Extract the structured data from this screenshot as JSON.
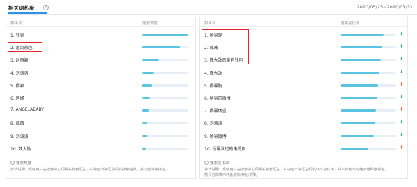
{
  "header": {
    "title": "相关词热度",
    "help_glyph": "?",
    "date_range": "2020/05/25~2020/05/31"
  },
  "left_panel": {
    "col_keyword": "相关词",
    "col_metric": "搜索热度",
    "rows": [
      {
        "label": "1.  钱睿",
        "level": 1.0
      },
      {
        "label": "2.  追风热芭",
        "level": 0.82
      },
      {
        "label": "3.  赵丽颖",
        "level": 0.36
      },
      {
        "label": "4.  刘诗诗",
        "level": 0.24
      },
      {
        "label": "5.  杨颖",
        "level": 0.2
      },
      {
        "label": "6.  唐嫣",
        "level": 0.16
      },
      {
        "label": "7.  ANGELABABY",
        "level": 0.13
      },
      {
        "label": "8.  戚薇",
        "level": 0.11
      },
      {
        "label": "9.  刘涛涛",
        "level": 0.1
      },
      {
        "label": "10. 魏大勋",
        "level": 0.08
      }
    ],
    "footer_title": "搜索热度",
    "footer_desc": "算法说明：反映用户在搜索中心词相关搜索汇总，并综合计算汇总词的搜索指数，并以此降序排名。"
  },
  "right_panel": {
    "col_keyword": "相关词",
    "col_metric": "搜索变化率",
    "rows": [
      {
        "label": "1.  杨幂穿",
        "level": 0.78,
        "trend": "down"
      },
      {
        "label": "2.  戚薇",
        "level": 0.75,
        "trend": "down"
      },
      {
        "label": "3.  魏大勋恋爱有钱吗",
        "level": 0.72,
        "trend": "down"
      },
      {
        "label": "4.  魏大勋",
        "level": 0.7,
        "trend": "down"
      },
      {
        "label": "5.  杨幂胸",
        "level": 0.68,
        "trend": "up"
      },
      {
        "label": "6.  杨幂的微博",
        "level": 0.66,
        "trend": "down"
      },
      {
        "label": "7.  杨幂体重",
        "level": 0.64,
        "trend": "up"
      },
      {
        "label": "8.  刘涛涛",
        "level": 0.62,
        "trend": "down"
      },
      {
        "label": "9.  杨幂微博",
        "level": 0.6,
        "trend": "down"
      },
      {
        "label": "10. 杨幂演过的电视剧",
        "level": 0.5,
        "trend": "up"
      }
    ],
    "footer_title": "搜索变化率",
    "footer_desc_line1": "算法说明：反映用户在搜索中心词相关搜索汇总，并综合计算汇总词的环比变化率，并以变化率的绝对值降序排名。",
    "footer_desc_line2": "箭头方向表示环比增加/环比下降。"
  },
  "colors": {
    "bar_fill": "#5bc4e3",
    "bar_track": "#e7eef5",
    "trend_down": "#3fb37f",
    "trend_up": "#f07050",
    "highlight_box": "#e0252b",
    "accent": "#2b93e8"
  },
  "icons": {
    "down": "arrow-down-icon",
    "up": "arrow-up-icon"
  }
}
